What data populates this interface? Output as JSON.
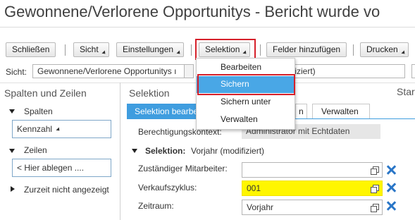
{
  "window": {
    "title": "Gewonnene/Verlorene Opportunitys - Bericht wurde vo"
  },
  "toolbar": {
    "close_label": "Schließen",
    "view_label": "Sicht",
    "settings_label": "Einstellungen",
    "selection_label": "Selektion",
    "add_fields_label": "Felder hinzufügen",
    "print_label": "Drucken"
  },
  "selection_menu": {
    "items": [
      "Bearbeiten",
      "Sichern",
      "Sichern unter",
      "Verwalten"
    ],
    "selected": "Sichern"
  },
  "view_bar": {
    "label": "Sicht:",
    "value": "Gewonnene/Verlorene Opportunitys ı",
    "suffix_text": "fiziert)"
  },
  "left_panel": {
    "title": "Spalten und Zeilen",
    "columns_label": "Spalten",
    "columns_value": "Kennzahl",
    "rows_label": "Zeilen",
    "rows_placeholder": "< Hier ablegen ....",
    "hidden_label": "Zurzeit nicht angezeigt"
  },
  "main_panel": {
    "title": "Selektion",
    "right_title_partial": "Star",
    "tabs": [
      "Selektion bearbeiten",
      "Verwalten"
    ],
    "tab_hidden_partial": "n",
    "authorization_label": "Berechtigungskontext:",
    "authorization_value": "Administrator mit Echtdaten",
    "selection_header_label": "Selektion:",
    "selection_header_value": "Vorjahr (modifiziert)",
    "fields": [
      {
        "label": "Zuständiger Mitarbeiter:",
        "value": ""
      },
      {
        "label": "Verkaufszyklus:",
        "value": "001"
      },
      {
        "label": "Zeitraum:",
        "value": "Vorjahr"
      }
    ]
  },
  "colors": {
    "accent": "#3f9ddf",
    "highlight_border": "#d6202a",
    "highlight_fill": "#fff600",
    "clear_icon": "#2a76c7"
  },
  "icons": [
    "copy-icon",
    "clear-icon",
    "expand-triangle-icon",
    "collapse-triangle-icon",
    "dropdown-caret-icon"
  ]
}
